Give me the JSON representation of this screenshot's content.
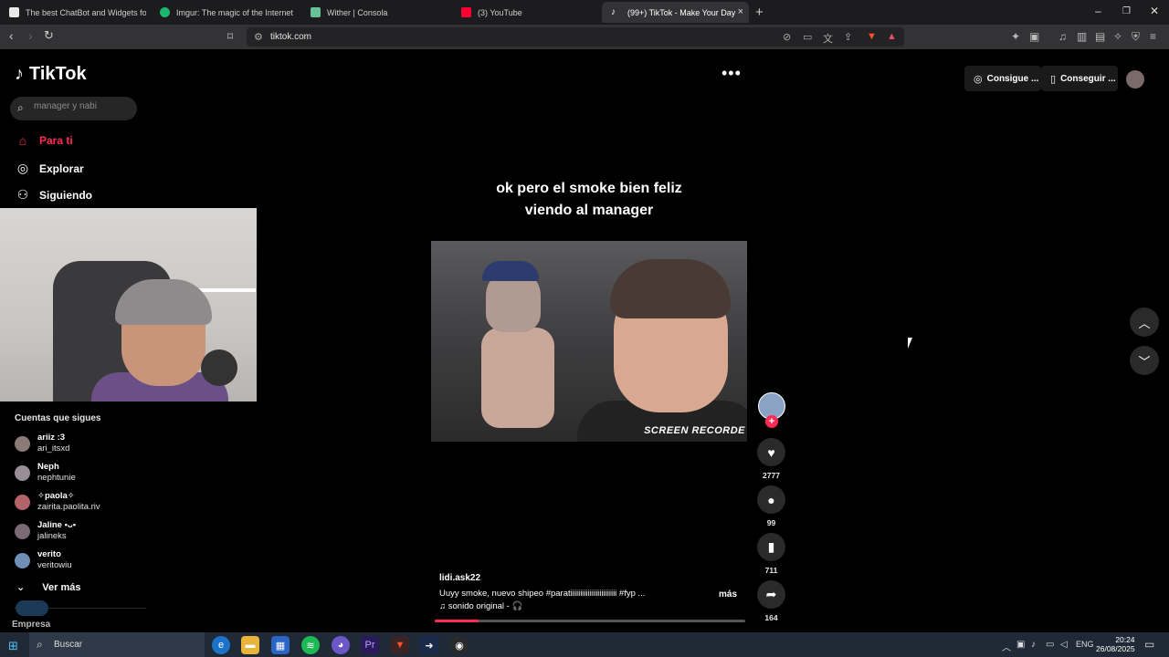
{
  "browser": {
    "tabs": [
      {
        "title": "The best ChatBot and Widgets for Kick",
        "favicon_color": "#e8e8e8"
      },
      {
        "title": "Imgur: The magic of the Internet",
        "favicon_color": "#1bb76e"
      },
      {
        "title": "Wither | Consola",
        "favicon_color": "#67c29a"
      },
      {
        "title": "(3) YouTube",
        "favicon_color": "#ff0033"
      },
      {
        "title": "(99+) TikTok - Make Your Day",
        "favicon_color": "#ffffff"
      }
    ],
    "new_tab_icon": "plus-icon",
    "url": "tiktok.com"
  },
  "tiktok": {
    "logo_text": "TikTok",
    "search_placeholder": "manager y nabi",
    "nav": [
      {
        "label": "Para ti",
        "icon": "home-icon"
      },
      {
        "label": "Explorar",
        "icon": "compass-icon"
      },
      {
        "label": "Siguiendo",
        "icon": "following-icon"
      }
    ],
    "following_title": "Cuentas que sigues",
    "accounts": [
      {
        "name": "ariiz :3",
        "username": "ari_itsxd"
      },
      {
        "name": "Neph",
        "username": "nephtunie"
      },
      {
        "name": "✧paola✧",
        "username": "zairita.paolita.riv"
      },
      {
        "name": "Jaline •ᴗ•",
        "username": "jalineks"
      },
      {
        "name": "verito",
        "username": "veritowiu"
      }
    ],
    "see_more": "Ver más",
    "empresa": "Empresa",
    "top_pills": [
      "Consigue ...",
      "Conseguir ..."
    ]
  },
  "video": {
    "caption_line1": "ok pero el smoke bien feliz",
    "caption_line2": "viendo al manager",
    "watermark": "SCREEN RECORDE",
    "author": "lidi.ask22",
    "description": "Uuyy smoke, nuevo shipeo #paratiiiiiiiiiiiiiiiiiiiiiiii  #fyp  ...",
    "more_label": "más",
    "sound": "♫ sonido original - 🎧",
    "progress_fraction": 0.14,
    "likes": "2777",
    "comments": "99",
    "saves": "711",
    "shares": "164"
  },
  "taskbar": {
    "search_label": "Buscar",
    "lang": "ENG",
    "time": "20:24",
    "date": "26/08/2025"
  },
  "colors": {
    "accent": "#fe2c55",
    "background": "#000000"
  }
}
